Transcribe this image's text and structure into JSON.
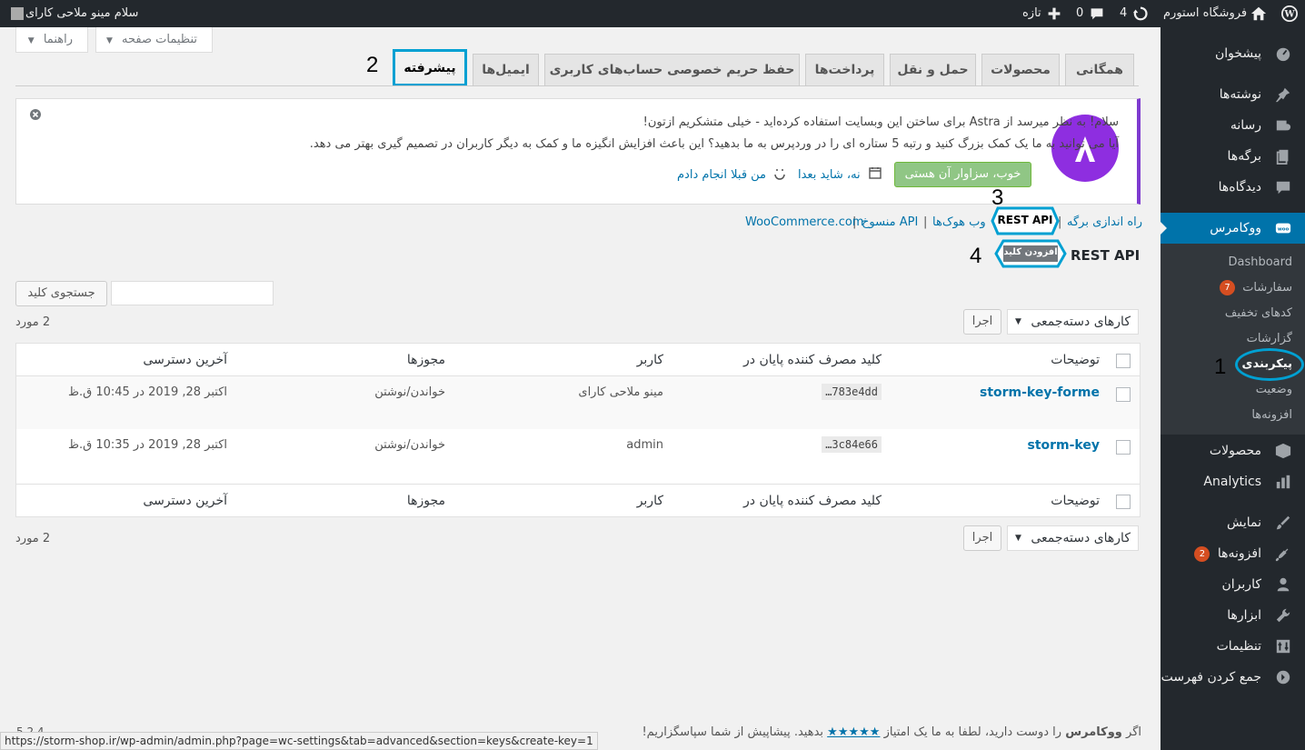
{
  "adminbar": {
    "greeting": "سلام مینو ملاحی کارای",
    "site_name": "فروشگاه استورم",
    "updates_count": "4",
    "comments_count": "0",
    "new_label": "تازه"
  },
  "sidebar": {
    "items": [
      {
        "label": "پیشخوان"
      },
      {
        "label": "نوشته‌ها"
      },
      {
        "label": "رسانه"
      },
      {
        "label": "برگه‌ها"
      },
      {
        "label": "دیدگاه‌ها"
      },
      {
        "label": "ووکامرس"
      },
      {
        "label": "محصولات"
      },
      {
        "label": "Analytics"
      },
      {
        "label": "نمایش"
      },
      {
        "label": "افزونه‌ها",
        "badge": "2"
      },
      {
        "label": "کاربران"
      },
      {
        "label": "ابزارها"
      },
      {
        "label": "تنظیمات"
      },
      {
        "label": "جمع کردن فهرست"
      }
    ],
    "submenu": [
      {
        "label": "Dashboard"
      },
      {
        "label": "سفارشات",
        "badge": "7"
      },
      {
        "label": "کدهای تخفیف"
      },
      {
        "label": "گزارشات"
      },
      {
        "label": "پیکربندی"
      },
      {
        "label": "وضعیت"
      },
      {
        "label": "افزونه‌ها"
      }
    ]
  },
  "screen_options": {
    "options_label": "تنظیمات صفحه",
    "help_label": "راهنما"
  },
  "tabs": [
    {
      "label": "همگانی"
    },
    {
      "label": "محصولات"
    },
    {
      "label": "حمل و نقل"
    },
    {
      "label": "پرداخت‌ها"
    },
    {
      "label": "حفظ حریم خصوصی حساب‌های کاربری"
    },
    {
      "label": "ایمیل‌ها"
    },
    {
      "label": "پیشرفته"
    }
  ],
  "notice": {
    "line1": "سلام! به نظر میرسد از Astra برای ساختن این وبسایت استفاده کرده‌اید - خیلی متشکریم ازتون!",
    "line2": "آیا می توانید به ما یک کمک بزرگ کنید و رتبه 5 ستاره ای را در وردپرس به ما بدهید؟ این باعث افزایش انگیزه ما و کمک به دیگر کاربران در تصمیم گیری بهتر می دهد.",
    "rate_button": "خوب، سزاوار آن هستی",
    "later_link": "نه، شاید بعدا",
    "done_link": "من قبلا انجام دادم"
  },
  "subsections": {
    "page_setup": "راه اندازی برگه",
    "rest_api": "REST API",
    "webhooks": "وب هوک‌ها",
    "legacy_api": "API منسوخ",
    "woocommerce_com": "WooCommerce.com",
    "sep": "|"
  },
  "heading": {
    "title": "REST API",
    "add_key": "افزودن کلید"
  },
  "search": {
    "button": "جستجوی کلید",
    "placeholder": ""
  },
  "bulk": {
    "select_label": "کارهای دسته‌جمعی",
    "apply_label": "اجرا",
    "items_count": "2 مورد"
  },
  "table": {
    "headers": {
      "description": "توضیحات",
      "consumer_key": "کلید مصرف کننده پایان در",
      "user": "کاربر",
      "permissions": "مجوزها",
      "last_access": "آخرین دسترسی"
    },
    "rows": [
      {
        "description": "storm-key-forme",
        "consumer_key": "…783e4dd",
        "user": "مینو ملاحی کارای",
        "permissions": "خواندن/نوشتن",
        "last_access": "اکتبر 28, 2019 در 10:45 ق.ظ"
      },
      {
        "description": "storm-key",
        "consumer_key": "…3c84e66",
        "user": "admin",
        "permissions": "خواندن/نوشتن",
        "last_access": "اکتبر 28, 2019 در 10:35 ق.ظ"
      }
    ]
  },
  "annotations": {
    "n1": "1",
    "n2": "2",
    "n3": "3",
    "n4": "4"
  },
  "footer": {
    "text_before": "اگر",
    "brand": "ووکامرس",
    "text_mid": "را دوست دارید، لطفا به ما یک امتیاز",
    "stars": "★★★★★",
    "text_after": "بدهید. پیشاپیش از شما سپاسگزاریم!",
    "version": "5.2.4",
    "status_url": "https://storm-shop.ir/wp-admin/admin.php?page=wc-settings&tab=advanced&section=keys&create-key=1"
  },
  "colors": {
    "accent": "#0073aa",
    "highlight": "#00a0d2",
    "sidebar": "#23282d",
    "astra": "#7e3bd0"
  }
}
